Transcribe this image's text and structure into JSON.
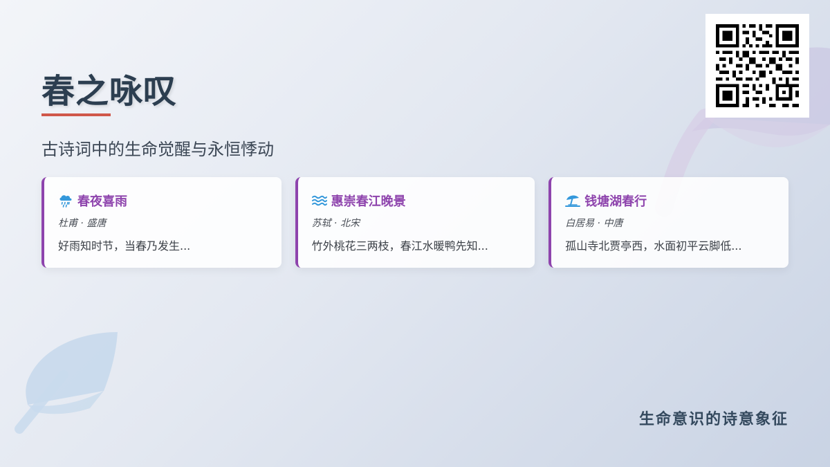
{
  "header": {
    "title": "春之咏叹",
    "subtitle": "古诗词中的生命觉醒与永恒悸动"
  },
  "cards": [
    {
      "icon": "cloud-rain-icon",
      "title": "春夜喜雨",
      "author": "杜甫 · 盛唐",
      "excerpt": "好雨知时节，当春乃发生..."
    },
    {
      "icon": "water-waves-icon",
      "title": "惠崇春江晚景",
      "author": "苏轼 · 北宋",
      "excerpt": "竹外桃花三两枝，春江水暖鸭先知..."
    },
    {
      "icon": "umbrella-beach-icon",
      "title": "钱塘湖春行",
      "author": "白居易 · 中唐",
      "excerpt": "孤山寺北贾亭西，水面初平云脚低..."
    }
  ],
  "footer": {
    "tagline": "生命意识的诗意象征"
  },
  "colors": {
    "accent_purple": "#8e44ad",
    "title_underline": "#d0584a",
    "icon_blue": "#3498db",
    "title_text": "#2c3e50"
  }
}
